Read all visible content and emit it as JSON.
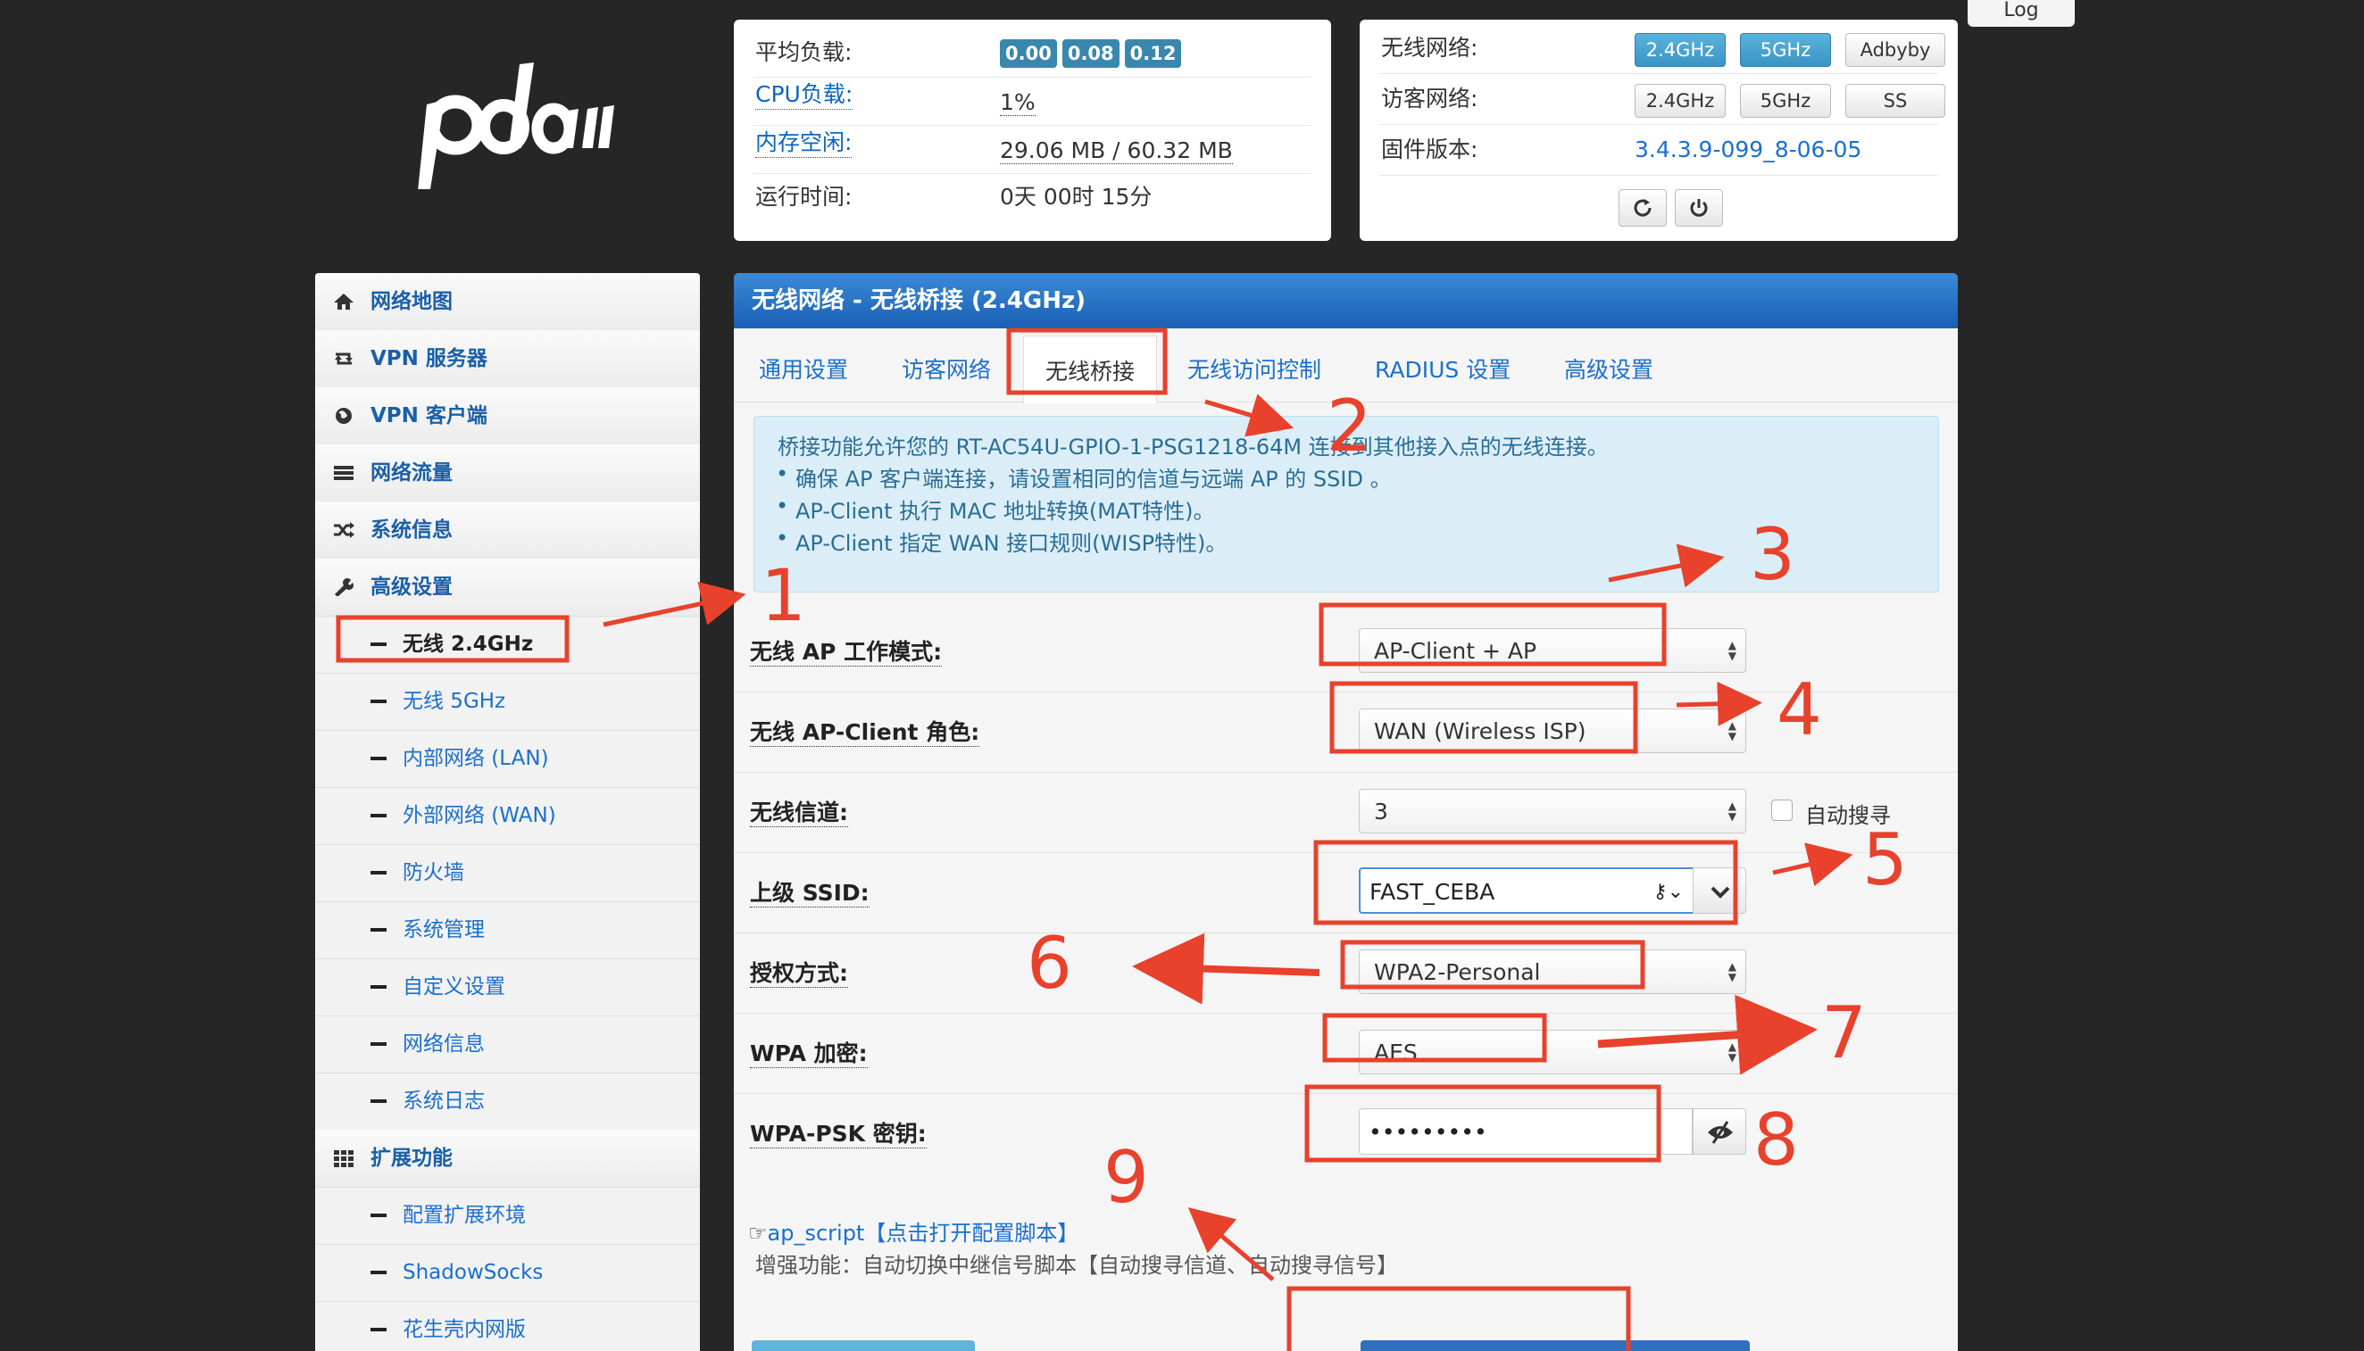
{
  "header": {
    "logo_text": "padavan",
    "log_label": "Log"
  },
  "status": {
    "load_label": "平均负载:",
    "load_values": [
      "0.00",
      "0.08",
      "0.12"
    ],
    "cpu_label": "CPU负载:",
    "cpu_value": "1%",
    "mem_label": "内存空闲:",
    "mem_value": "29.06 MB / 60.32 MB",
    "uptime_label": "运行时间:",
    "uptime_value": "0天 00时 15分"
  },
  "wifi_panel": {
    "wireless_label": "无线网络:",
    "wireless_buttons": [
      "2.4GHz",
      "5GHz",
      "Adbyby"
    ],
    "guest_label": "访客网络:",
    "guest_buttons": [
      "2.4GHz",
      "5GHz",
      "SS"
    ],
    "firmware_label": "固件版本:",
    "firmware_value": "3.4.3.9-099_8-06-05",
    "refresh_icon": "refresh-icon",
    "power_icon": "power-icon"
  },
  "sidebar": {
    "items": [
      {
        "label": "网络地图",
        "icon": "home-icon"
      },
      {
        "label": "VPN 服务器",
        "icon": "retweet-icon"
      },
      {
        "label": "VPN 客户端",
        "icon": "globe-icon"
      },
      {
        "label": "网络流量",
        "icon": "list-icon"
      },
      {
        "label": "系统信息",
        "icon": "shuffle-icon"
      },
      {
        "label": "高级设置",
        "icon": "wrench-icon"
      }
    ],
    "sub_advanced": [
      "无线 2.4GHz",
      "无线 5GHz",
      "内部网络 (LAN)",
      "外部网络 (WAN)",
      "防火墙",
      "系统管理",
      "自定义设置",
      "网络信息",
      "系统日志"
    ],
    "ext_label": "扩展功能",
    "ext_icon": "grid-icon",
    "sub_ext": [
      "配置扩展环境",
      "ShadowSocks",
      "花生壳内网版"
    ]
  },
  "main": {
    "title": "无线网络 - 无线桥接 (2.4GHz)",
    "tabs": [
      "通用设置",
      "访客网络",
      "无线桥接",
      "无线访问控制",
      "RADIUS 设置",
      "高级设置"
    ],
    "info": {
      "intro": "桥接功能允许您的 RT-AC54U-GPIO-1-PSG1218-64M 连接到其他接入点的无线连接。",
      "bullets": [
        "确保 AP 客户端连接，请设置相同的信道与远端 AP 的 SSID 。",
        "AP-Client 执行 MAC 地址转换(MAT特性)。",
        "AP-Client 指定 WAN 接口规则(WISP特性)。"
      ]
    },
    "fields": {
      "mode_label": "无线 AP 工作模式:",
      "mode_value": "AP-Client + AP",
      "role_label": "无线 AP-Client 角色:",
      "role_value": "WAN (Wireless ISP)",
      "channel_label": "无线信道:",
      "channel_value": "3",
      "auto_search_label": "自动搜寻",
      "ssid_label": "上级 SSID:",
      "ssid_value": "FAST_CEBA",
      "auth_label": "授权方式:",
      "auth_value": "WPA2-Personal",
      "enc_label": "WPA 加密:",
      "enc_value": "AES",
      "psk_label": "WPA-PSK 密钥:",
      "psk_value": "•••••••••"
    },
    "script_link": "ap_script【点击打开配置脚本】",
    "script_desc": "增强功能：自动切换中继信号脚本【自动搜寻信道、自动搜寻信号】"
  },
  "annotations": [
    "1",
    "2",
    "3",
    "4",
    "5",
    "6",
    "7",
    "8",
    "9"
  ],
  "colors": {
    "annotation": "#e8412c",
    "header_blue": "#1a5fb5",
    "badge": "#3a87ad"
  }
}
